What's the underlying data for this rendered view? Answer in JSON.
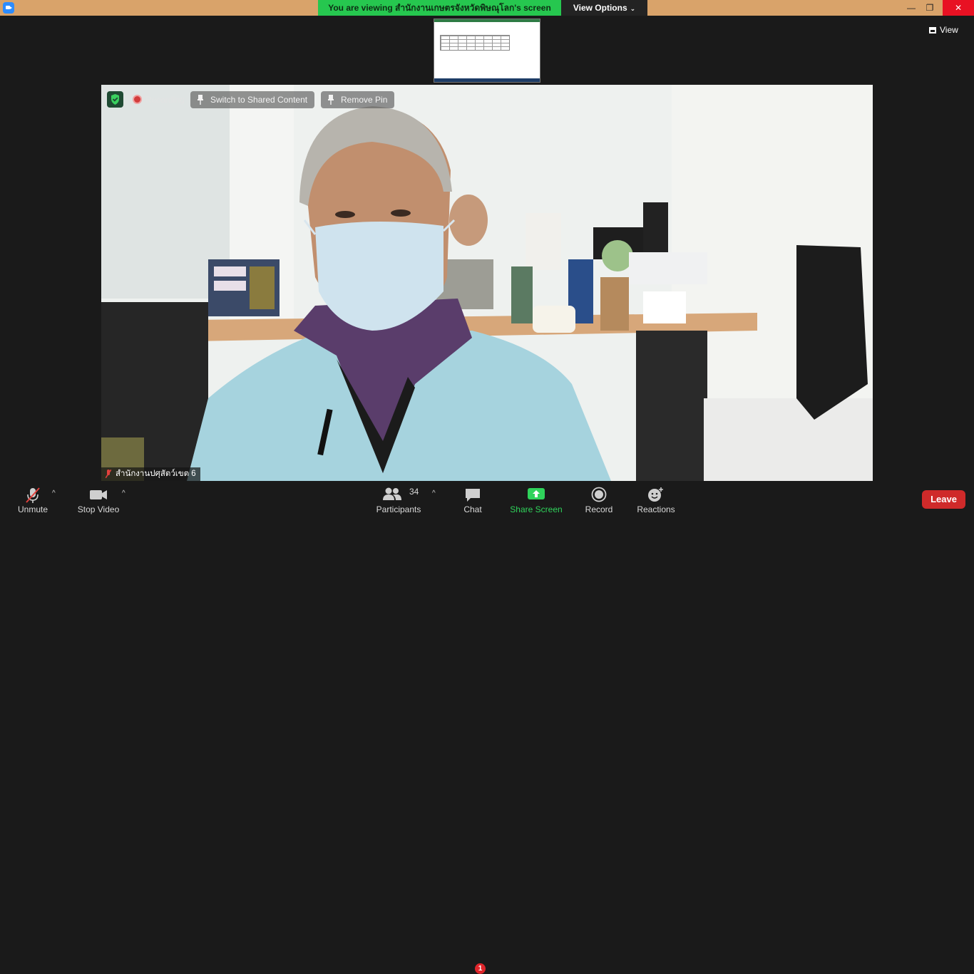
{
  "window": {
    "viewing_banner": "You are viewing สำนักงานเกษตรจังหวัดพิษณุโลก's screen",
    "view_options": "View Options",
    "view_button": "View"
  },
  "video": {
    "recording_label": "Recording",
    "switch_label": "Switch to Shared Content",
    "remove_pin_label": "Remove Pin",
    "participant_name": "สำนักงานปศุสัตว์เขต 6"
  },
  "toolbar": {
    "unmute": "Unmute",
    "stop_video": "Stop Video",
    "participants": "Participants",
    "participants_count": "34",
    "chat": "Chat",
    "chat_badge": "1",
    "share_screen": "Share Screen",
    "record": "Record",
    "reactions": "Reactions",
    "leave": "Leave"
  },
  "colors": {
    "banner_green": "#26c74f",
    "leave_red": "#cf2a2a",
    "share_green": "#2fd35b",
    "titlebar": "#d9a36a"
  }
}
